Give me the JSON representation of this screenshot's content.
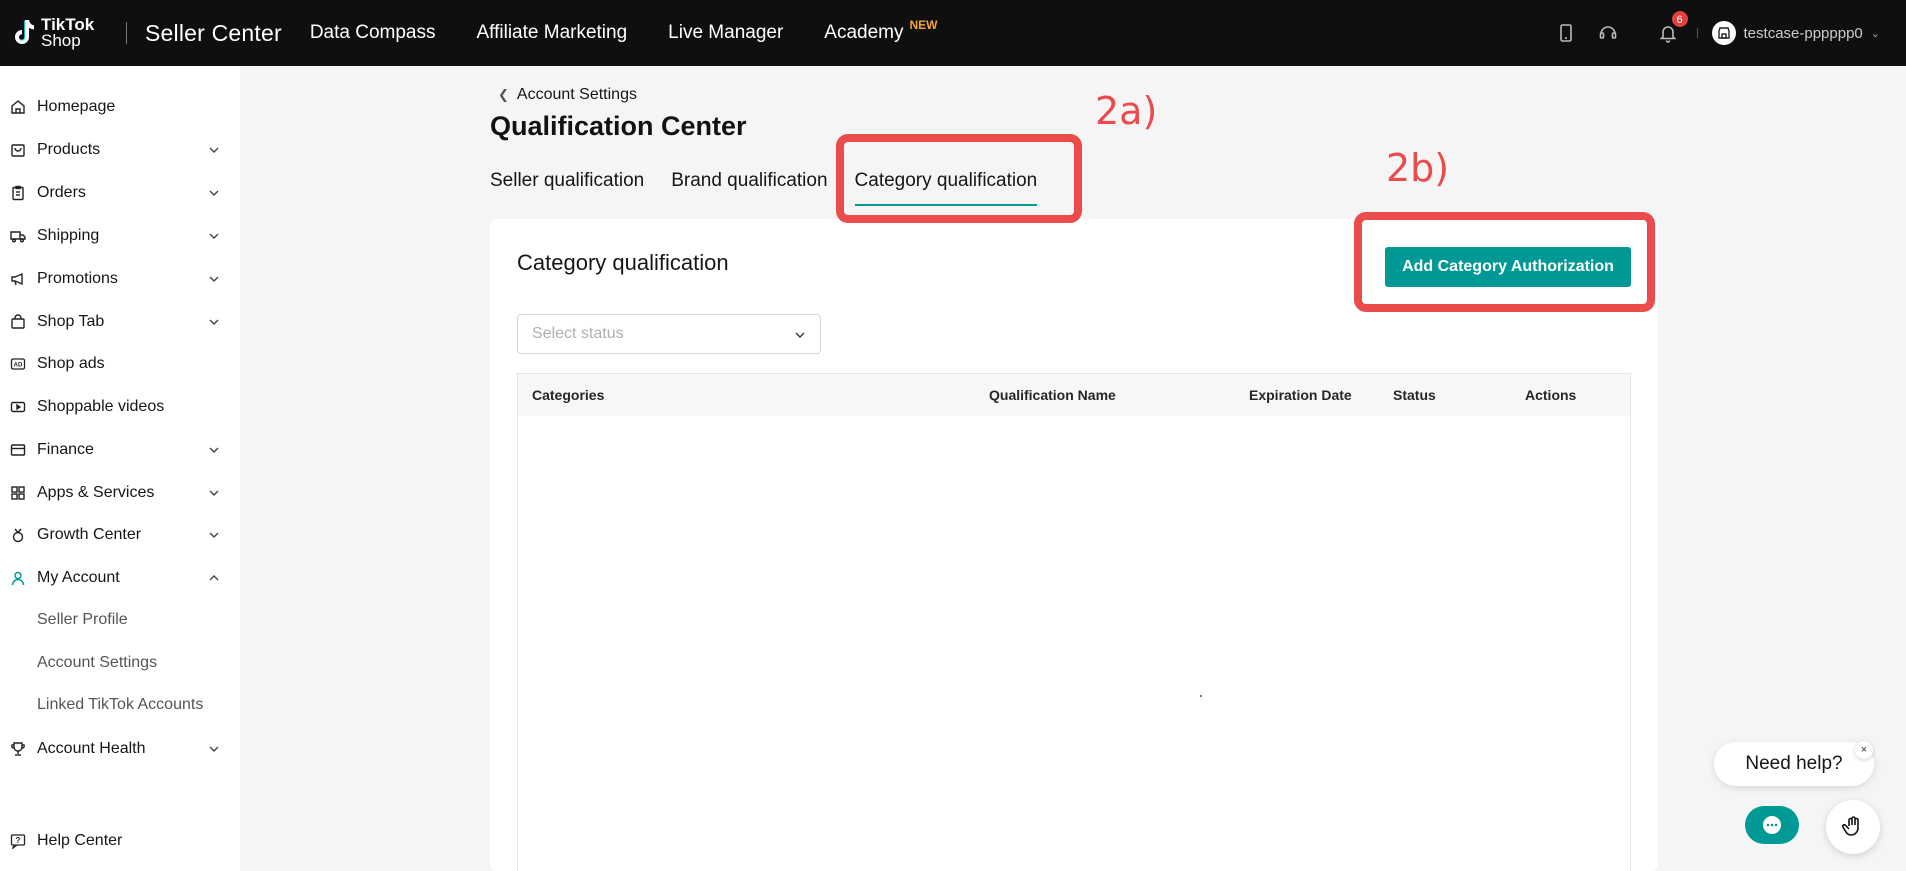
{
  "topbar": {
    "logo_line1": "TikTok",
    "logo_line2": "Shop",
    "brand": "Seller Center",
    "nav": [
      "Data Compass",
      "Affiliate Marketing",
      "Live Manager",
      "Academy"
    ],
    "new_badge": "NEW",
    "notification_count": "6",
    "account_name": "testcase-pppppp0"
  },
  "sidebar": {
    "items": [
      {
        "label": "Homepage",
        "icon": "home-icon"
      },
      {
        "label": "Products",
        "icon": "bag-icon"
      },
      {
        "label": "Orders",
        "icon": "clipboard-icon"
      },
      {
        "label": "Shipping",
        "icon": "truck-icon"
      },
      {
        "label": "Promotions",
        "icon": "megaphone-icon"
      },
      {
        "label": "Shop Tab",
        "icon": "shopping-bag-icon"
      },
      {
        "label": "Shop ads",
        "icon": "ad-icon"
      },
      {
        "label": "Shoppable videos",
        "icon": "video-icon"
      },
      {
        "label": "Finance",
        "icon": "wallet-icon"
      },
      {
        "label": "Apps & Services",
        "icon": "grid-icon"
      },
      {
        "label": "Growth Center",
        "icon": "medal-icon"
      },
      {
        "label": "My Account",
        "icon": "user-icon"
      },
      {
        "label": "Account Health",
        "icon": "trophy-icon"
      }
    ],
    "sub_items": [
      "Seller Profile",
      "Account Settings",
      "Linked TikTok Accounts"
    ],
    "help_center": "Help Center"
  },
  "main": {
    "back_label": "Account Settings",
    "title": "Qualification Center",
    "tabs": [
      "Seller qualification",
      "Brand qualification",
      "Category qualification"
    ],
    "annotation_a": "2a)",
    "annotation_b": "2b)",
    "card_title": "Category qualification",
    "add_button": "Add Category Authorization",
    "select_placeholder": "Select status",
    "columns": [
      "Categories",
      "Qualification Name",
      "Expiration Date",
      "Status",
      "Actions"
    ]
  },
  "help": {
    "bubble": "Need help?",
    "close": "×"
  },
  "colors": {
    "accent": "#009995",
    "annotation": "#ea4c4c",
    "topbar": "#0f0f0f",
    "new_badge": "#f7a531"
  }
}
